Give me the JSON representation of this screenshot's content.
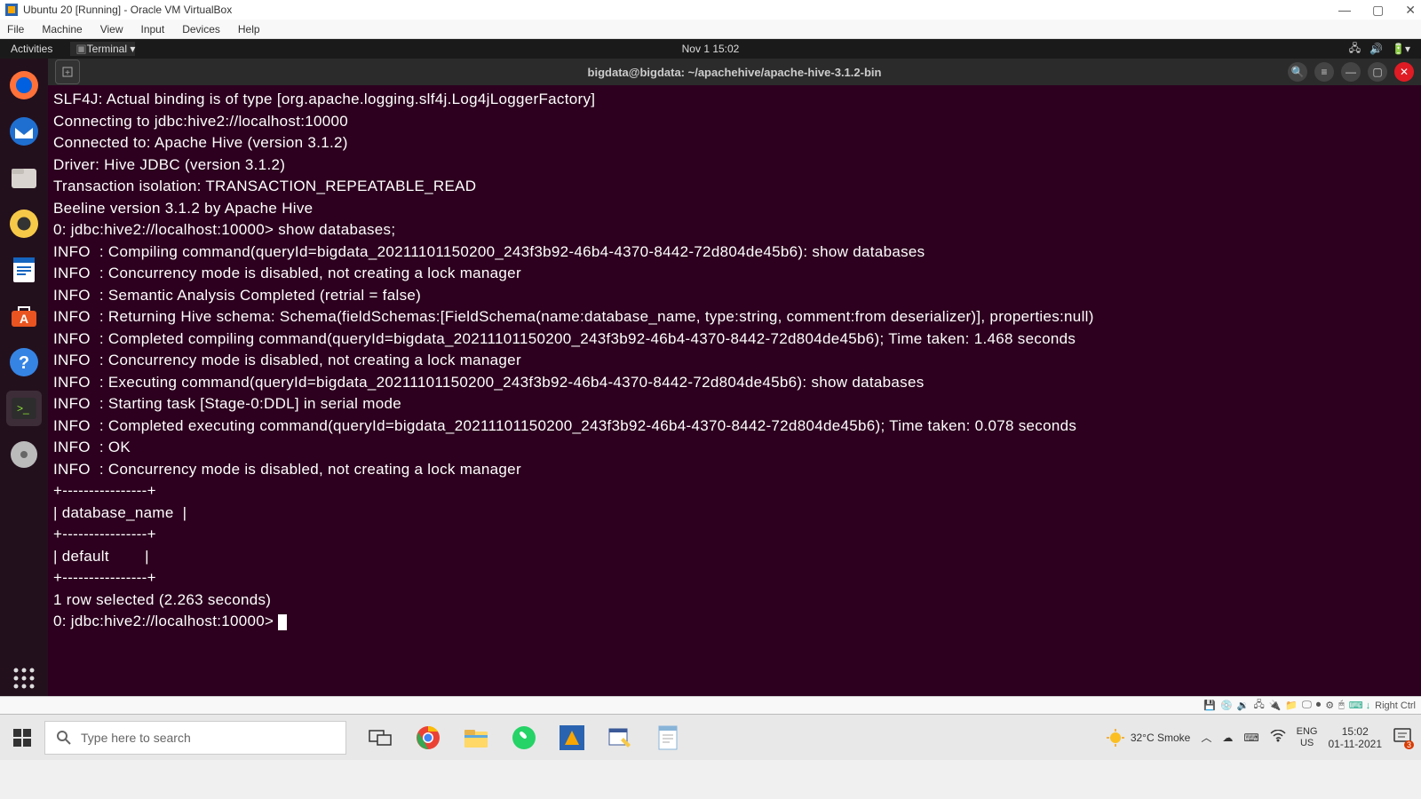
{
  "winTitle": "Ubuntu 20 [Running] - Oracle VM VirtualBox",
  "vbMenu": [
    "File",
    "Machine",
    "View",
    "Input",
    "Devices",
    "Help"
  ],
  "gnome": {
    "activities": "Activities",
    "app": "Terminal ▾",
    "time": "Nov 1  15:02"
  },
  "termTitle": "bigdata@bigdata: ~/apachehive/apache-hive-3.1.2-bin",
  "termText": "SLF4J: Actual binding is of type [org.apache.logging.slf4j.Log4jLoggerFactory]\nConnecting to jdbc:hive2://localhost:10000\nConnected to: Apache Hive (version 3.1.2)\nDriver: Hive JDBC (version 3.1.2)\nTransaction isolation: TRANSACTION_REPEATABLE_READ\nBeeline version 3.1.2 by Apache Hive\n0: jdbc:hive2://localhost:10000> show databases;\nINFO  : Compiling command(queryId=bigdata_20211101150200_243f3b92-46b4-4370-8442-72d804de45b6): show databases\nINFO  : Concurrency mode is disabled, not creating a lock manager\nINFO  : Semantic Analysis Completed (retrial = false)\nINFO  : Returning Hive schema: Schema(fieldSchemas:[FieldSchema(name:database_name, type:string, comment:from deserializer)], properties:null)\nINFO  : Completed compiling command(queryId=bigdata_20211101150200_243f3b92-46b4-4370-8442-72d804de45b6); Time taken: 1.468 seconds\nINFO  : Concurrency mode is disabled, not creating a lock manager\nINFO  : Executing command(queryId=bigdata_20211101150200_243f3b92-46b4-4370-8442-72d804de45b6): show databases\nINFO  : Starting task [Stage-0:DDL] in serial mode\nINFO  : Completed executing command(queryId=bigdata_20211101150200_243f3b92-46b4-4370-8442-72d804de45b6); Time taken: 0.078 seconds\nINFO  : OK\nINFO  : Concurrency mode is disabled, not creating a lock manager\n+----------------+\n| database_name  |\n+----------------+\n| default        |\n+----------------+\n1 row selected (2.263 seconds)\n0: jdbc:hive2://localhost:10000> ",
  "searchPlaceholder": "Type here to search",
  "weather": "32°C  Smoke",
  "lang1": "ENG",
  "lang2": "US",
  "time": "15:02",
  "date": "01-11-2021",
  "hostKey": "Right Ctrl",
  "notifCount": "3"
}
